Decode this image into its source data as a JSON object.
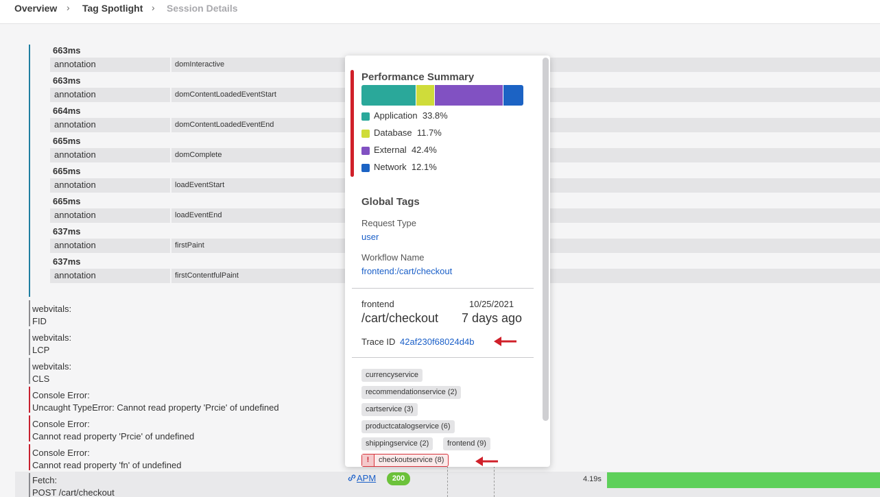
{
  "breadcrumb": {
    "items": [
      "Overview",
      "Tag Spotlight",
      "Session Details"
    ]
  },
  "annotations": [
    {
      "time": "663ms",
      "key": "annotation",
      "value": "domInteractive"
    },
    {
      "time": "663ms",
      "key": "annotation",
      "value": "domContentLoadedEventStart"
    },
    {
      "time": "664ms",
      "key": "annotation",
      "value": "domContentLoadedEventEnd"
    },
    {
      "time": "665ms",
      "key": "annotation",
      "value": "domComplete"
    },
    {
      "time": "665ms",
      "key": "annotation",
      "value": "loadEventStart"
    },
    {
      "time": "665ms",
      "key": "annotation",
      "value": "loadEventEnd"
    },
    {
      "time": "637ms",
      "key": "annotation",
      "value": "firstPaint"
    },
    {
      "time": "637ms",
      "key": "annotation",
      "value": "firstContentfulPaint"
    }
  ],
  "events": [
    {
      "line1": "webvitals:",
      "line2": "FID"
    },
    {
      "line1": "webvitals:",
      "line2": "LCP"
    },
    {
      "line1": "webvitals:",
      "line2": "CLS"
    },
    {
      "line1": "Console Error:",
      "line2": "Uncaught TypeError: Cannot read property 'Prcie' of undefined"
    },
    {
      "line1": "Console Error:",
      "line2": "Cannot read property 'Prcie' of undefined"
    },
    {
      "line1": "Console Error:",
      "line2": "Cannot read property 'fn' of undefined"
    },
    {
      "line1": "Fetch:",
      "line2": "POST /cart/checkout"
    }
  ],
  "fetch_row": {
    "apm_label": "APM",
    "status": "200",
    "duration": "4.19s"
  },
  "popover": {
    "perf_title": "Performance Summary",
    "perf": [
      {
        "label": "Application",
        "pct": "33.8%",
        "value": 33.8,
        "color": "#2aa89a"
      },
      {
        "label": "Database",
        "pct": "11.7%",
        "value": 11.7,
        "color": "#cfdc3a"
      },
      {
        "label": "External",
        "pct": "42.4%",
        "value": 42.4,
        "color": "#8151c2"
      },
      {
        "label": "Network",
        "pct": "12.1%",
        "value": 12.1,
        "color": "#1c63c4"
      }
    ],
    "global_tags_title": "Global Tags",
    "request_type_label": "Request Type",
    "request_type_value": "user",
    "workflow_label": "Workflow Name",
    "workflow_value": "frontend:/cart/checkout",
    "service": "frontend",
    "date": "10/25/2021",
    "path": "/cart/checkout",
    "ago": "7 days ago",
    "trace_label": "Trace ID",
    "trace_id": "42af230f68024d4b",
    "services": [
      {
        "label": "currencyservice",
        "error": false
      },
      {
        "label": "recommendationservice (2)",
        "error": false
      },
      {
        "label": "cartservice (3)",
        "error": false
      },
      {
        "label": "productcatalogservice (6)",
        "error": false
      },
      {
        "label": "shippingservice (2)",
        "error": false
      },
      {
        "label": "frontend (9)",
        "error": false
      },
      {
        "label": "checkoutservice (8)",
        "error": true,
        "badge": "!"
      }
    ]
  },
  "colors": {
    "accent_link": "#1a5fc8",
    "error": "#c8202f",
    "success": "#6cc23a",
    "annotation_bar": "#1f7ea0"
  }
}
